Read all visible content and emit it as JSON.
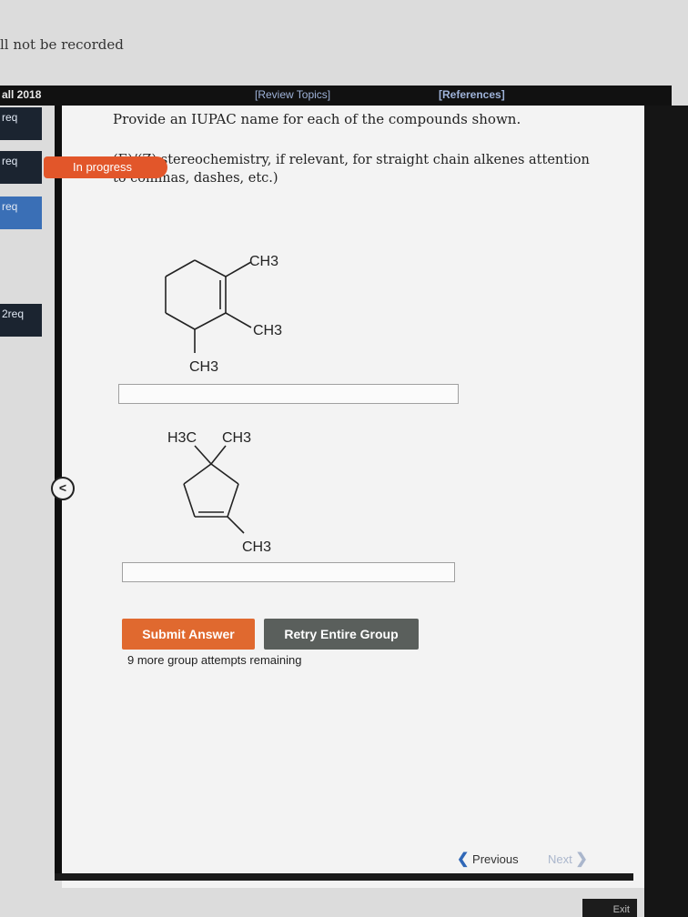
{
  "top_note": "ll not be recorded",
  "header": {
    "course": "all 2018",
    "review_topics": "[Review Topics]",
    "references": "[References]"
  },
  "sidebar": {
    "items": [
      {
        "label": "req"
      },
      {
        "label": "req"
      },
      {
        "label": "req"
      },
      {
        "label": "2req"
      }
    ]
  },
  "status_badge": "In progress",
  "question": "Provide an IUPAC name for each of the compounds shown.",
  "instruction": "(E)/(Z) stereochemistry, if relevant, for straight chain alkenes attention to commas, dashes, etc.)",
  "molecule1": {
    "labels": [
      "CH3",
      "CH3",
      "CH3"
    ]
  },
  "molecule2": {
    "labels": [
      "H3C",
      "CH3",
      "CH3"
    ]
  },
  "answer1": {
    "value": ""
  },
  "answer2": {
    "value": ""
  },
  "buttons": {
    "submit": "Submit Answer",
    "retry": "Retry Entire Group"
  },
  "attempts_text": "9 more group attempts remaining",
  "nav": {
    "previous": "Previous",
    "next": "Next"
  },
  "exit_label": "Exit",
  "colors": {
    "accent_orange": "#e0692f",
    "sidebar_blue": "#3a6fb6",
    "retry_gray": "#5a5f5c"
  }
}
